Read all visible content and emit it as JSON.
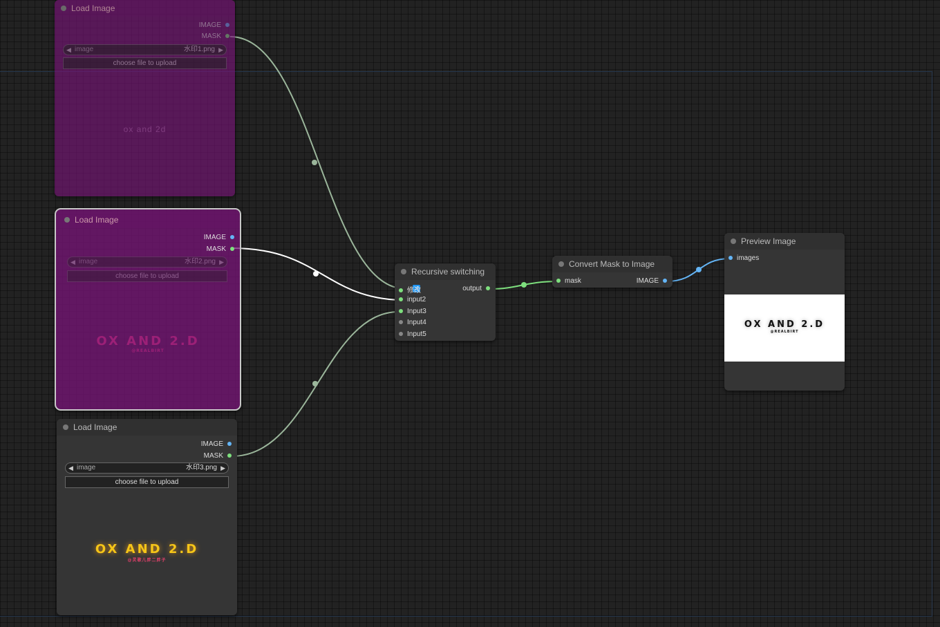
{
  "nodes": {
    "load1": {
      "title": "Load Image",
      "out_image": "IMAGE",
      "out_mask": "MASK",
      "widget_label": "image",
      "widget_value": "水印1.png",
      "upload_label": "choose file to upload",
      "preview_text": "ox and 2d"
    },
    "load2": {
      "title": "Load Image",
      "out_image": "IMAGE",
      "out_mask": "MASK",
      "widget_label": "image",
      "widget_value": "水印2.png",
      "upload_label": "choose file to upload",
      "logo_main": "OX AND 2.D",
      "logo_sub": "@REALBIRT"
    },
    "load3": {
      "title": "Load Image",
      "out_image": "IMAGE",
      "out_mask": "MASK",
      "widget_label": "image",
      "widget_value": "水印3.png",
      "upload_label": "choose file to upload",
      "logo_main": "OX AND 2.D",
      "logo_sub": "@灵歌儿胖二胖子"
    },
    "recursive": {
      "title": "Recursive switching",
      "title_icon": "shuffle-icon",
      "inputs": [
        "修改",
        "input2",
        "Input3",
        "Input4",
        "Input5"
      ],
      "output": "output"
    },
    "convert": {
      "title": "Convert Mask to Image",
      "input": "mask",
      "output": "IMAGE"
    },
    "preview": {
      "title": "Preview Image",
      "input": "images",
      "logo_main": "OX AND 2.D",
      "logo_sub": "@REALBIRT"
    }
  },
  "colors": {
    "canvas": "#222222",
    "node": "#353535",
    "bypass": "#7a1478",
    "link_mask": "#9bb69b",
    "link_image": "#64b5f6",
    "link_active": "#ffffff",
    "logo_yellow": "#f5c518",
    "logo_pink": "#c2185b"
  }
}
